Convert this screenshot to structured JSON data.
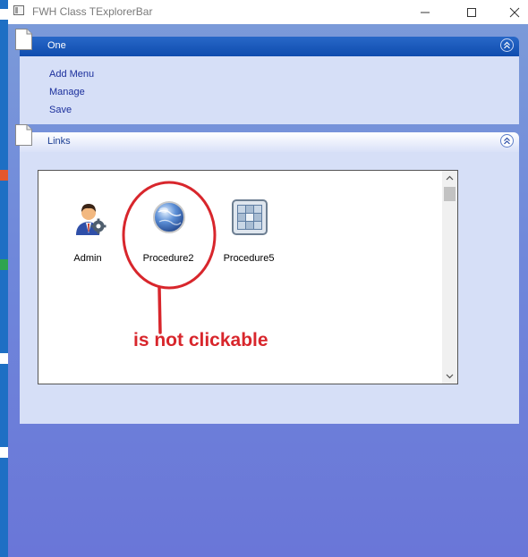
{
  "window": {
    "title": "FWH Class TExplorerBar",
    "minimize_icon": "minimize-icon",
    "maximize_icon": "maximize-icon",
    "close_icon": "close-icon"
  },
  "groups": [
    {
      "title": "One",
      "collapse_icon": "double-chevron-up-icon",
      "links": [
        "Add Menu",
        "Manage",
        "Save"
      ]
    },
    {
      "title": "Links",
      "collapse_icon": "double-chevron-up-icon",
      "items": [
        {
          "label": "Admin",
          "icon": "admin-user-gear-icon"
        },
        {
          "label": "Procedure2",
          "icon": "globe-icon"
        },
        {
          "label": "Procedure5",
          "icon": "grid-table-icon"
        }
      ]
    }
  ],
  "annotation": {
    "text": "is not clickable",
    "color": "#d8262c"
  },
  "colors": {
    "header_active": "#1550b8",
    "panel_body": "#d6dff7",
    "link_text": "#1b2f9c",
    "background": "#6f87da"
  }
}
